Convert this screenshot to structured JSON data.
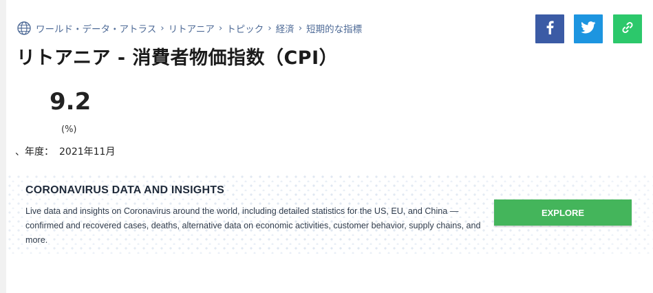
{
  "breadcrumb": {
    "icon": "globe-icon",
    "items": [
      "ワールド・データ・アトラス",
      "リトアニア",
      "トピック",
      "経済",
      "短期的な指標"
    ],
    "separator": "›"
  },
  "title": "リトアニア - 消費者物価指数（CPI）",
  "indicator": {
    "value": "9.2",
    "unit": "(%)",
    "year_label": "、年度：",
    "year_value": "2021年11月"
  },
  "share": {
    "facebook": "facebook-icon",
    "twitter": "twitter-icon",
    "link": "link-icon",
    "colors": {
      "facebook": "#3b5ba5",
      "twitter": "#1d95e0",
      "link": "#2cc86b"
    }
  },
  "banner": {
    "heading": "CORONAVIRUS DATA AND INSIGHTS",
    "text": "Live data and insights on Coronavirus around the world, including detailed statistics for the US, EU, and China — confirmed and recovered cases, deaths, alternative data on economic activities, customer behavior, supply chains, and more.",
    "button_label": "EXPLORE",
    "button_color": "#44b55b"
  }
}
